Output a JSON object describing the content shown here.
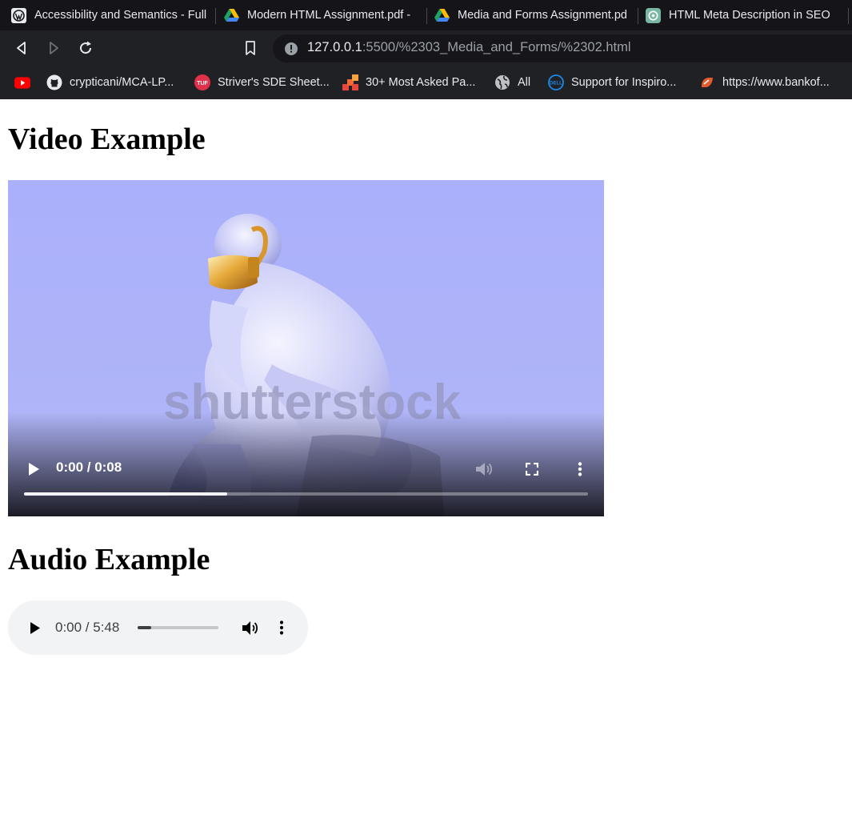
{
  "browser": {
    "tabs": [
      {
        "title": "Accessibility and Semantics - Full",
        "icon": "wordpress-icon"
      },
      {
        "title": "Modern HTML Assignment.pdf -",
        "icon": "google-drive-icon"
      },
      {
        "title": "Media and Forms Assignment.pd",
        "icon": "google-drive-icon"
      },
      {
        "title": "HTML Meta Description in SEO",
        "icon": "chatgpt-icon"
      }
    ],
    "url": {
      "host": "127.0.0.1",
      "path": ":5500/%2303_Media_and_Forms/%2302.html"
    },
    "bookmarks": [
      {
        "label": "",
        "icon": "youtube-icon"
      },
      {
        "label": "crypticani/MCA-LP...",
        "icon": "github-icon"
      },
      {
        "label": "Striver's SDE Sheet...",
        "icon": "tuf-icon"
      },
      {
        "label": "30+ Most Asked Pa...",
        "icon": "grid-icon"
      },
      {
        "label": "All",
        "icon": "globe-icon"
      },
      {
        "label": "Support for Inspiro...",
        "icon": "dell-icon"
      },
      {
        "label": "https://www.bankof...",
        "icon": "bank-icon"
      }
    ]
  },
  "page": {
    "video_heading": "Video Example",
    "audio_heading": "Audio Example",
    "video": {
      "time": "0:00 / 0:08",
      "watermark": "shutterstock",
      "progress": 0.36
    },
    "audio": {
      "time": "0:00 / 5:48",
      "progress": 0.17
    }
  }
}
